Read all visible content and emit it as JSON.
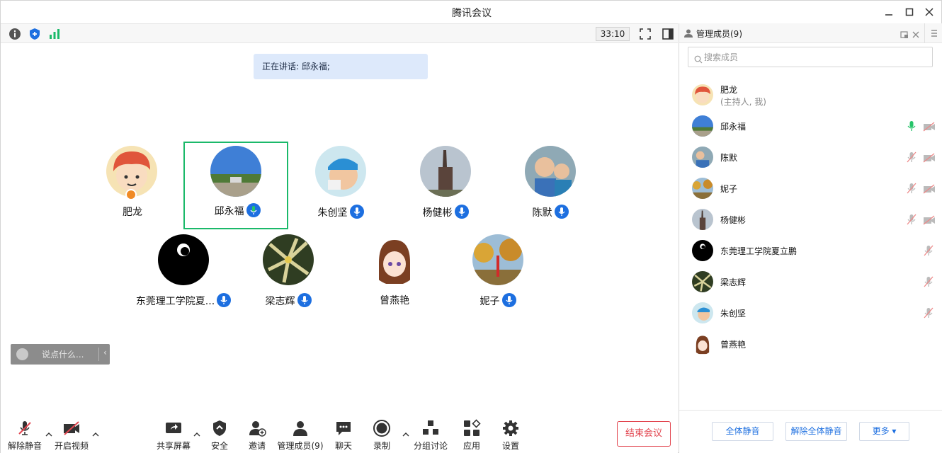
{
  "window": {
    "title": "腾讯会议",
    "controls": [
      "minimize-icon",
      "maximize-icon",
      "close-icon"
    ]
  },
  "meeting_bar": {
    "icons": [
      "info-icon",
      "shield-icon",
      "signal-icon"
    ],
    "timer": "33:10",
    "right_icons": [
      "fullscreen-icon",
      "panel-toggle-icon"
    ]
  },
  "stage": {
    "speaking_label": "正在讲话: 邱永福;",
    "chat_placeholder": "说点什么...",
    "participants": [
      {
        "name": "肥龙",
        "mic": "none",
        "host": true,
        "active": false
      },
      {
        "name": "邱永福",
        "mic": "speaking",
        "host": false,
        "active": true
      },
      {
        "name": "朱创坚",
        "mic": "on",
        "host": false,
        "active": false
      },
      {
        "name": "杨健彬",
        "mic": "on",
        "host": false,
        "active": false
      },
      {
        "name": "陈默",
        "mic": "on",
        "host": false,
        "active": false
      },
      {
        "name": "东莞理工学院夏...",
        "mic": "on",
        "host": false,
        "active": false
      },
      {
        "name": "梁志辉",
        "mic": "on",
        "host": false,
        "active": false
      },
      {
        "name": "曾燕艳",
        "mic": "none",
        "host": false,
        "active": false
      },
      {
        "name": "妮子",
        "mic": "on",
        "host": false,
        "active": false
      }
    ]
  },
  "toolbar": {
    "unmute": "解除静音",
    "start_video": "开启视频",
    "share_screen": "共享屏幕",
    "security": "安全",
    "invite": "邀请",
    "manage_members": "管理成员(9)",
    "chat": "聊天",
    "record": "录制",
    "breakout": "分组讨论",
    "apps": "应用",
    "settings": "设置",
    "end_meeting": "结束会议"
  },
  "panel": {
    "title": "管理成员(9)",
    "search_placeholder": "搜索成员",
    "members": [
      {
        "name": "肥龙",
        "role": "(主持人, 我)",
        "mic": "none",
        "cam": "none"
      },
      {
        "name": "邱永福",
        "role": "",
        "mic": "speaking",
        "cam": "off"
      },
      {
        "name": "陈默",
        "role": "",
        "mic": "muted",
        "cam": "off"
      },
      {
        "name": "妮子",
        "role": "",
        "mic": "muted",
        "cam": "off"
      },
      {
        "name": "杨健彬",
        "role": "",
        "mic": "muted",
        "cam": "off"
      },
      {
        "name": "东莞理工学院夏立鹏",
        "role": "",
        "mic": "muted",
        "cam": "none"
      },
      {
        "name": "梁志辉",
        "role": "",
        "mic": "muted",
        "cam": "none"
      },
      {
        "name": "朱创坚",
        "role": "",
        "mic": "muted",
        "cam": "none"
      },
      {
        "name": "曾燕艳",
        "role": "",
        "mic": "none",
        "cam": "none"
      }
    ],
    "mute_all": "全体静音",
    "unmute_all": "解除全体静音",
    "more": "更多 ▾"
  },
  "colors": {
    "accent_blue": "#1d6fe0",
    "active_green": "#1bb96a",
    "end_red": "#e2454f",
    "speaking_bg": "#dde9fb"
  }
}
